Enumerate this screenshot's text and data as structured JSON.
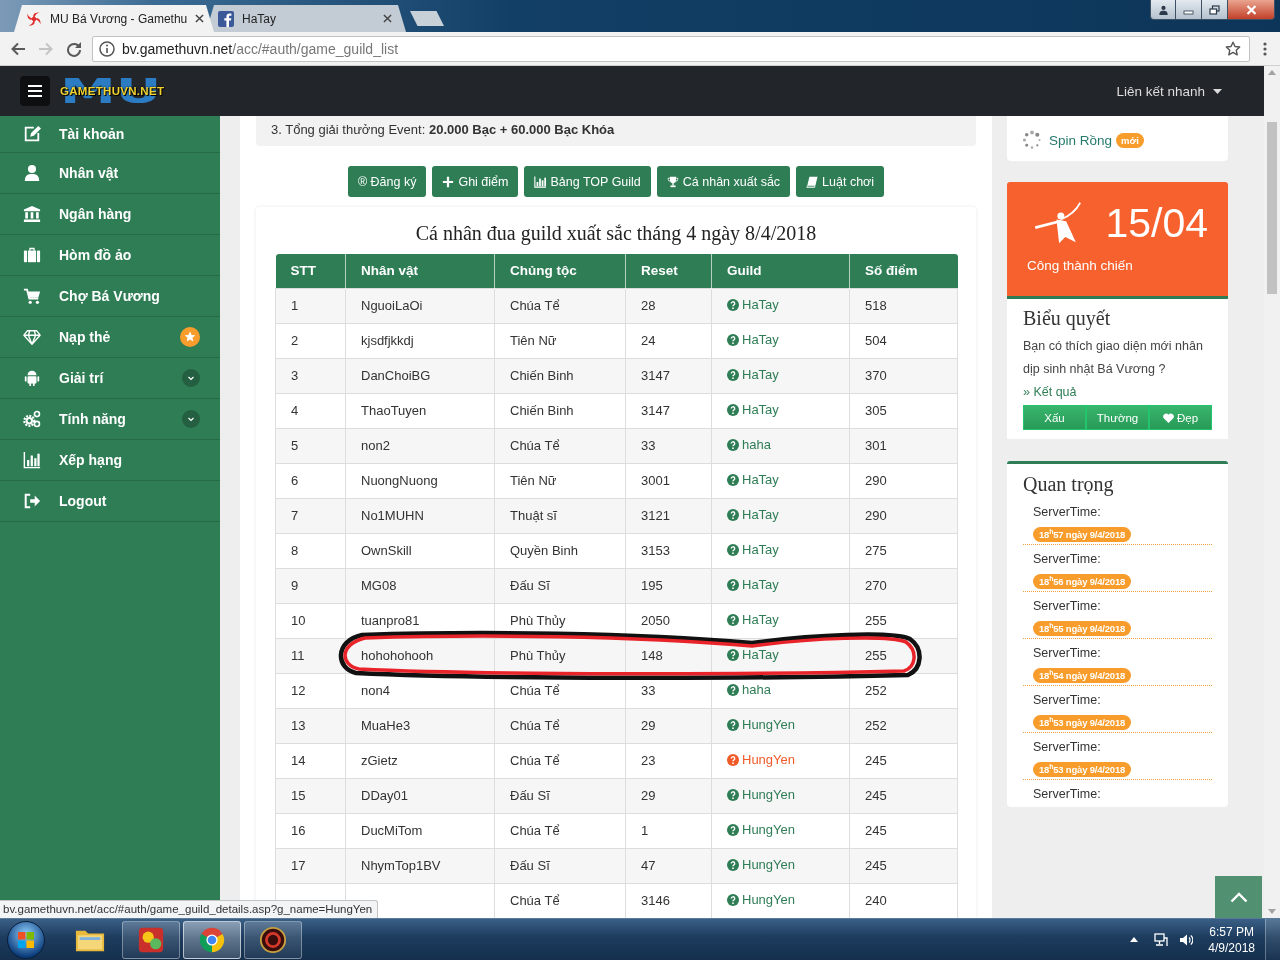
{
  "browser": {
    "tabs": [
      {
        "title": "MU Bá Vương - Gamethu",
        "selected": true
      },
      {
        "title": "HaTay",
        "selected": false
      }
    ],
    "forward_disabled": true,
    "url": {
      "host": "bv.gamethuvn.net",
      "path": "/acc/#auth/game_guild_list"
    }
  },
  "header": {
    "logo": {
      "backdrop": "MU",
      "text": "GAMETHUVN.NET"
    },
    "quick_links": "Liên kết nhanh"
  },
  "sidebar": {
    "items": [
      {
        "label": "Tài khoản",
        "kind": "link"
      },
      {
        "label": "Nhân vật",
        "kind": "link"
      },
      {
        "label": "Ngân hàng",
        "kind": "link"
      },
      {
        "label": "Hòm đồ ảo",
        "kind": "link"
      },
      {
        "label": "Chợ Bá Vương",
        "kind": "link"
      },
      {
        "label": "Nạp thẻ",
        "kind": "featured"
      },
      {
        "label": "Giải trí",
        "kind": "submenu",
        "expanded": false
      },
      {
        "label": "Tính năng",
        "kind": "submenu",
        "expanded": false
      },
      {
        "label": "Xếp hạng",
        "kind": "link"
      },
      {
        "label": "Logout",
        "kind": "link"
      }
    ]
  },
  "notice": "3. Tổng giải thưởng Event: **20.000 Bạc + 60.000 Bạc Khóa**",
  "actions": [
    "® Đăng ký",
    "Ghi điểm",
    "Bảng TOP Guild",
    "Cá nhân xuất sắc",
    "Luật chơi"
  ],
  "ranking": {
    "title": "Cá nhân đua guild xuất sắc tháng 4 ngày 8/4/2018",
    "columns": [
      "STT",
      "Nhân vật",
      "Chủng tộc",
      "Reset",
      "Guild",
      "Số điểm"
    ],
    "rows": [
      {
        "stt": "1",
        "name": "NguoiLaOi",
        "race": "Chúa Tể",
        "reset": "28",
        "guild": {
          "name": "HaTay",
          "hovered": false
        },
        "points": "518",
        "circled": false
      },
      {
        "stt": "2",
        "name": "kjsdfjkkdj",
        "race": "Tiên Nữ",
        "reset": "24",
        "guild": {
          "name": "HaTay",
          "hovered": false
        },
        "points": "504",
        "circled": false
      },
      {
        "stt": "3",
        "name": "DanChoiBG",
        "race": "Chiến Binh",
        "reset": "3147",
        "guild": {
          "name": "HaTay",
          "hovered": false
        },
        "points": "370",
        "circled": false
      },
      {
        "stt": "4",
        "name": "ThaoTuyen",
        "race": "Chiến Binh",
        "reset": "3147",
        "guild": {
          "name": "HaTay",
          "hovered": false
        },
        "points": "305",
        "circled": false
      },
      {
        "stt": "5",
        "name": "non2",
        "race": "Chúa Tể",
        "reset": "33",
        "guild": {
          "name": "haha",
          "hovered": false
        },
        "points": "301",
        "circled": false
      },
      {
        "stt": "6",
        "name": "NuongNuong",
        "race": "Tiên Nữ",
        "reset": "3001",
        "guild": {
          "name": "HaTay",
          "hovered": false
        },
        "points": "290",
        "circled": false
      },
      {
        "stt": "7",
        "name": "No1MUHN",
        "race": "Thuật sĩ",
        "reset": "3121",
        "guild": {
          "name": "HaTay",
          "hovered": false
        },
        "points": "290",
        "circled": false
      },
      {
        "stt": "8",
        "name": "OwnSkill",
        "race": "Quyền Binh",
        "reset": "3153",
        "guild": {
          "name": "HaTay",
          "hovered": false
        },
        "points": "275",
        "circled": false
      },
      {
        "stt": "9",
        "name": "MG08",
        "race": "Đấu Sĩ",
        "reset": "195",
        "guild": {
          "name": "HaTay",
          "hovered": false
        },
        "points": "270",
        "circled": false
      },
      {
        "stt": "10",
        "name": "tuanpro81",
        "race": "Phù Thủy",
        "reset": "2050",
        "guild": {
          "name": "HaTay",
          "hovered": false
        },
        "points": "255",
        "circled": false
      },
      {
        "stt": "11",
        "name": "hohohohooh",
        "race": "Phù Thủy",
        "reset": "148",
        "guild": {
          "name": "HaTay",
          "hovered": false
        },
        "points": "255",
        "circled": true
      },
      {
        "stt": "12",
        "name": "non4",
        "race": "Chúa Tể",
        "reset": "33",
        "guild": {
          "name": "haha",
          "hovered": false
        },
        "points": "252",
        "circled": false
      },
      {
        "stt": "13",
        "name": "MuaHe3",
        "race": "Chúa Tể",
        "reset": "29",
        "guild": {
          "name": "HungYen",
          "hovered": false
        },
        "points": "252",
        "circled": false
      },
      {
        "stt": "14",
        "name": "zGietz",
        "race": "Chúa Tể",
        "reset": "23",
        "guild": {
          "name": "HungYen",
          "hovered": true
        },
        "points": "245",
        "circled": false
      },
      {
        "stt": "15",
        "name": "DDay01",
        "race": "Đấu Sĩ",
        "reset": "29",
        "guild": {
          "name": "HungYen",
          "hovered": false
        },
        "points": "245",
        "circled": false
      },
      {
        "stt": "16",
        "name": "DucMiTom",
        "race": "Chúa Tể",
        "reset": "1",
        "guild": {
          "name": "HungYen",
          "hovered": false
        },
        "points": "245",
        "circled": false
      },
      {
        "stt": "17",
        "name": "NhymTop1BV",
        "race": "Đấu Sĩ",
        "reset": "47",
        "guild": {
          "name": "HungYen",
          "hovered": false
        },
        "points": "245",
        "circled": false
      },
      {
        "race": "Chúa Tể",
        "reset": "3146",
        "guild": {
          "name": "HungYen",
          "hovered": false
        },
        "points": "240",
        "circled": false
      }
    ]
  },
  "quick_panel": {
    "links": [
      {
        "label": "Spin Rồng",
        "badge": "mới"
      }
    ]
  },
  "event": {
    "date": "15/04",
    "name": "Công thành chiến"
  },
  "poll": {
    "title": "Biểu quyết",
    "question": "Bạn có thích giao diện mới nhân dịp sinh nhật Bá Vương ?",
    "result_link": "» Kết quả",
    "options": [
      "Xấu",
      "Thường",
      "Đẹp"
    ]
  },
  "important": {
    "title": "Quan trọng",
    "entries": [
      {
        "label": "ServerTime:",
        "time": "18$^{h}$57 ngày 9/4/2018"
      },
      {
        "label": "ServerTime:",
        "time": "18$^{h}$56 ngày 9/4/2018"
      },
      {
        "label": "ServerTime:",
        "time": "18$^{h}$55 ngày 9/4/2018"
      },
      {
        "label": "ServerTime:",
        "time": "18$^{h}$54 ngày 9/4/2018"
      },
      {
        "label": "ServerTime:",
        "time": "18$^{h}$53 ngày 9/4/2018"
      },
      {
        "label": "ServerTime:",
        "time": "18$^{h}$53 ngày 9/4/2018"
      },
      {
        "label": "ServerTime:"
      }
    ]
  },
  "status_url": "bv.gamethuvn.net/acc/#auth/game_guild_details.asp?g_name=HungYen",
  "taskbar": {
    "apps": [
      {
        "running": false,
        "selected": false
      },
      {
        "running": true,
        "selected": false
      },
      {
        "running": true,
        "selected": true
      },
      {
        "running": true,
        "selected": false
      }
    ],
    "clock": {
      "time": "6:57 PM",
      "date": "4/9/2018"
    }
  }
}
